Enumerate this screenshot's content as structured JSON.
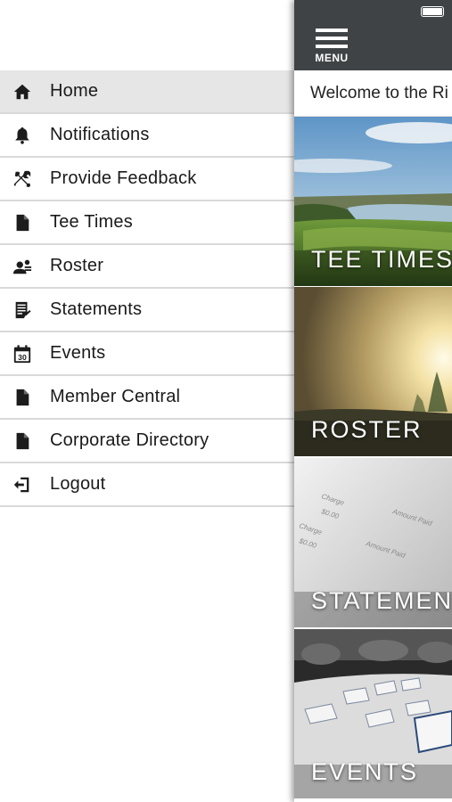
{
  "drawer": {
    "items": [
      {
        "label": "Home",
        "icon": "home-icon",
        "active": true
      },
      {
        "label": "Notifications",
        "icon": "bell-icon",
        "active": false
      },
      {
        "label": "Provide Feedback",
        "icon": "tools-icon",
        "active": false
      },
      {
        "label": "Tee Times",
        "icon": "document-icon",
        "active": false
      },
      {
        "label": "Roster",
        "icon": "roster-icon",
        "active": false
      },
      {
        "label": "Statements",
        "icon": "statement-icon",
        "active": false
      },
      {
        "label": "Events",
        "icon": "calendar-icon",
        "active": false
      },
      {
        "label": "Member Central",
        "icon": "document-icon",
        "active": false
      },
      {
        "label": "Corporate Directory",
        "icon": "document-icon",
        "active": false
      },
      {
        "label": "Logout",
        "icon": "logout-icon",
        "active": false
      }
    ],
    "calendar_day": "30"
  },
  "main": {
    "menu_label": "MENU",
    "welcome_text": "Welcome to the Ri",
    "tiles": [
      {
        "label": "TEE TIMES"
      },
      {
        "label": "ROSTER"
      },
      {
        "label": "STATEMEN"
      },
      {
        "label": "EVENTS"
      }
    ],
    "statement_snippets": [
      "Charge",
      "$0.00",
      "Amount Paid",
      "Charge",
      "$0.00",
      "Amount Paid"
    ]
  },
  "colors": {
    "topbar": "#3f4346",
    "active_item": "#e6e6e6",
    "divider": "#d9d9d9"
  }
}
